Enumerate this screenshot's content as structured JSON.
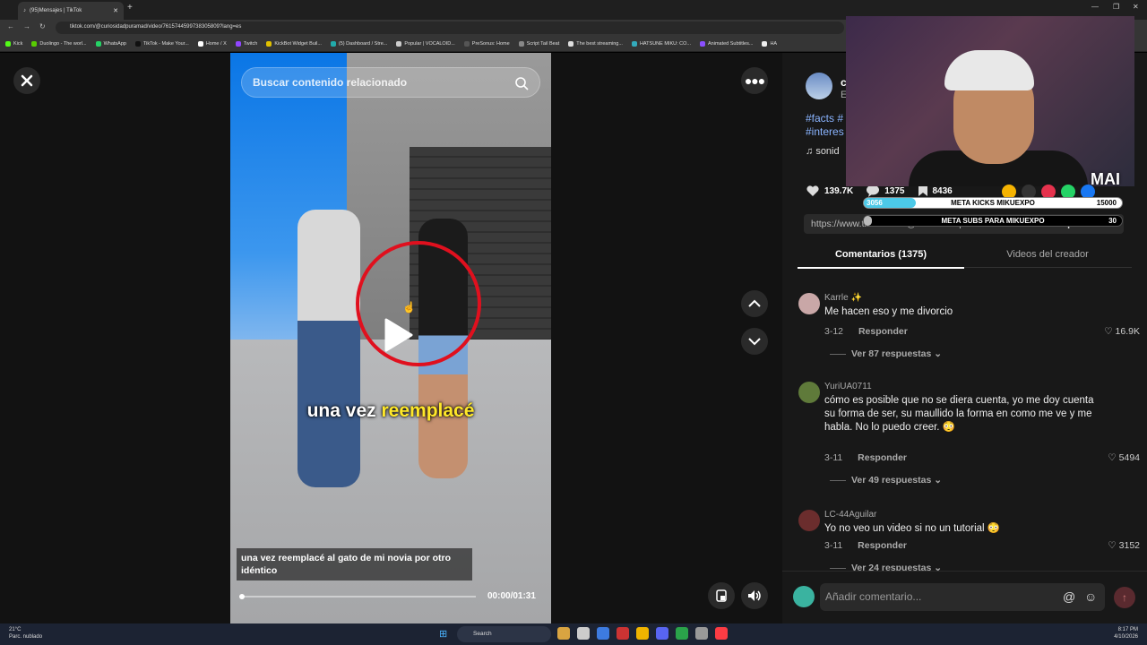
{
  "browser": {
    "tab_title": "(95)Mensajes | TikTok",
    "url": "tiktok.com/@curiosidadpuramad/video/7615744599738305809?lang=es",
    "bookmarks": [
      "Kick",
      "Duolingo - The worl...",
      "WhatsApp",
      "TikTok - Make Your...",
      "Home / X",
      "Twitch",
      "KickBot Widget Buil...",
      "(5) Dashboard / Stre...",
      "Popular | VOCALOID...",
      "PreSonus: Home",
      "Script Tail Beat",
      "The best streaming...",
      "HATSUNE MIKU: CO...",
      "Animated Subtitles...",
      "HA"
    ]
  },
  "video": {
    "search_placeholder": "Buscar contenido relacionado",
    "subtitle_plain": "una vez",
    "subtitle_highlight": "reemplacé",
    "caption": "una vez reemplacé al gato de mi novia por otro idéntico",
    "time": "00:00/01:31",
    "progress": 0.0
  },
  "creator": {
    "name": "c",
    "sub": "E",
    "tags": [
      "#facts #",
      "#interes"
    ],
    "sound": "sonid"
  },
  "stats": {
    "likes": "139.7K",
    "comments": "1375",
    "saves": "8436"
  },
  "link": {
    "url": "https://www.tiktok.com/@curiosidadpuramad/vide...",
    "copy": "Copiar enlace"
  },
  "tabs": {
    "comments": "Comentarios (1375)",
    "creator_videos": "Videos del creador"
  },
  "comments": [
    {
      "user": "Karrle ✨",
      "text": "Me hacen eso y me divorcio",
      "date": "3-12",
      "reply": "Responder",
      "likes": "16.9K",
      "more": "Ver 87 respuestas ⌄"
    },
    {
      "user": "YuriUA0711",
      "text": "cómo es posible que no se diera cuenta, yo me doy cuenta su forma de ser, su maullido la forma en como me ve y me habla. No lo puedo creer. 😳",
      "date": "3-11",
      "reply": "Responder",
      "likes": "5494",
      "more": "Ver 49 respuestas ⌄"
    },
    {
      "user": "LC-44Aguilar",
      "text": "Yo no veo un video si no un tutorial 😳",
      "date": "3-11",
      "reply": "Responder",
      "likes": "3152",
      "more": "Ver 24 respuestas ⌄"
    }
  ],
  "comment_input": {
    "placeholder": "Añadir comentario..."
  },
  "overlay": {
    "cam_label": "MAI",
    "goal1_pre": "3056",
    "goal1_label": "META KICKS MIKUEXPO",
    "goal1_num": "15000",
    "goal1_progress": 0.2,
    "goal2_label": "META SUBS PARA MIKUEXPO",
    "goal2_num": "30",
    "goal2_progress": 0.03
  },
  "taskbar": {
    "weather_temp": "21°C",
    "weather_desc": "Parc. nublado",
    "search": "Search",
    "time": "8:17 PM",
    "date": "4/10/2026"
  }
}
